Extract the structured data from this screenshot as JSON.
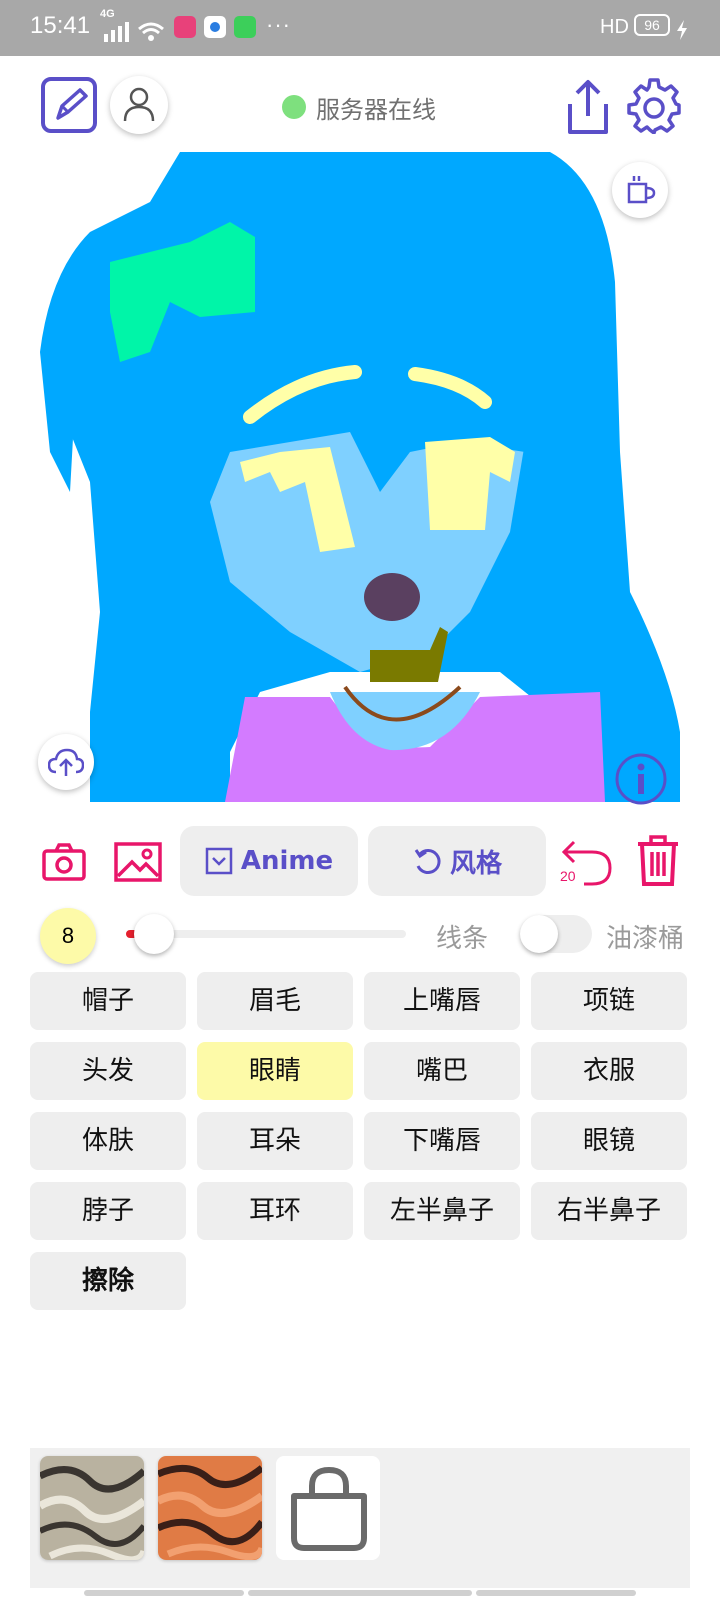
{
  "status_bar": {
    "time": "15:41",
    "network": "4G",
    "more": "···",
    "hd": "HD",
    "battery": "96"
  },
  "toolbar": {
    "server_status": "服务器在线",
    "server_color": "#7ee07e",
    "accent_color": "#5a4fc8"
  },
  "canvas": {
    "background": "#ffffff",
    "hair_color": "#00a8ff",
    "skin_color": "#7fd0ff",
    "clothes_color": "#d37bff",
    "bow_color": "#00f5a8",
    "eye_color": "#ffffa8"
  },
  "tools": {
    "anime_label": "Anime",
    "style_label": "风格",
    "undo_count": "20"
  },
  "brush": {
    "size": "8",
    "slider_value": 0.08,
    "line_label": "线条",
    "bucket_label": "油漆桶",
    "bucket_on": false
  },
  "parts": [
    {
      "label": "帽子"
    },
    {
      "label": "眉毛"
    },
    {
      "label": "上嘴唇"
    },
    {
      "label": "项链"
    },
    {
      "label": "头发"
    },
    {
      "label": "眼睛"
    },
    {
      "label": "嘴巴"
    },
    {
      "label": "衣服"
    },
    {
      "label": "体肤"
    },
    {
      "label": "耳朵"
    },
    {
      "label": "下嘴唇"
    },
    {
      "label": "眼镜"
    },
    {
      "label": "脖子"
    },
    {
      "label": "耳环"
    },
    {
      "label": "左半鼻子"
    },
    {
      "label": "右半鼻子"
    },
    {
      "label": "擦除"
    }
  ],
  "selected_part": "眼睛",
  "gallery": {
    "items": [
      "texture-gray",
      "texture-orange",
      "shopping-bag-icon"
    ]
  }
}
